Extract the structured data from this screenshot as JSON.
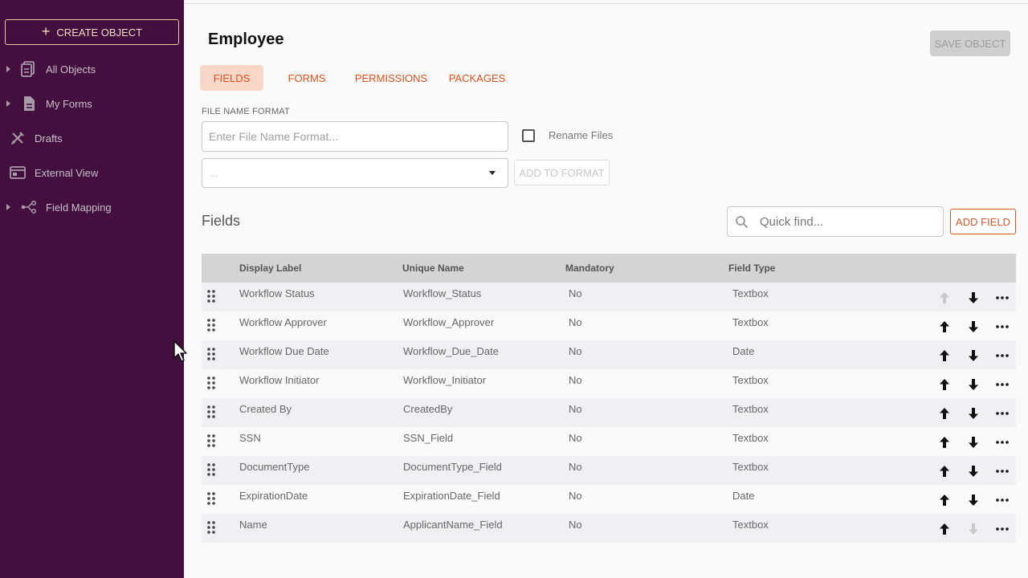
{
  "sidebar": {
    "create_label": "CREATE OBJECT",
    "items": [
      {
        "label": "All Objects",
        "icon": "objects-icon",
        "expandable": true
      },
      {
        "label": "My Forms",
        "icon": "forms-icon",
        "expandable": true
      },
      {
        "label": "Drafts",
        "icon": "drafts-icon",
        "expandable": false
      },
      {
        "label": "External View",
        "icon": "external-view-icon",
        "expandable": false
      },
      {
        "label": "Field Mapping",
        "icon": "field-mapping-icon",
        "expandable": true
      }
    ]
  },
  "header": {
    "title": "Employee",
    "save_label": "SAVE OBJECT"
  },
  "tabs": [
    {
      "label": "FIELDS",
      "active": true
    },
    {
      "label": "FORMS",
      "active": false
    },
    {
      "label": "PERMISSIONS",
      "active": false
    },
    {
      "label": "PACKAGES",
      "active": false
    }
  ],
  "file_name": {
    "label": "FILE NAME FORMAT",
    "placeholder": "Enter File Name Format...",
    "rename_label": "Rename Files",
    "select_value": "...",
    "add_to_format_label": "ADD TO FORMAT"
  },
  "fields_section": {
    "heading": "Fields",
    "search_placeholder": "Quick find...",
    "add_field_label": "ADD FIELD"
  },
  "table": {
    "columns": [
      "Display Label",
      "Unique Name",
      "Mandatory",
      "Field Type"
    ],
    "rows": [
      {
        "display": "Workflow Status",
        "unique": "Workflow_Status",
        "mandatory": "No",
        "type": "Textbox"
      },
      {
        "display": "Workflow Approver",
        "unique": "Workflow_Approver",
        "mandatory": "No",
        "type": "Textbox"
      },
      {
        "display": "Workflow Due Date",
        "unique": "Workflow_Due_Date",
        "mandatory": "No",
        "type": "Date"
      },
      {
        "display": "Workflow Initiator",
        "unique": "Workflow_Initiator",
        "mandatory": "No",
        "type": "Textbox"
      },
      {
        "display": "Created By",
        "unique": "CreatedBy",
        "mandatory": "No",
        "type": "Textbox"
      },
      {
        "display": "SSN",
        "unique": "SSN_Field",
        "mandatory": "No",
        "type": "Textbox"
      },
      {
        "display": "DocumentType",
        "unique": "DocumentType_Field",
        "mandatory": "No",
        "type": "Textbox"
      },
      {
        "display": "ExpirationDate",
        "unique": "ExpirationDate_Field",
        "mandatory": "No",
        "type": "Date"
      },
      {
        "display": "Name",
        "unique": "ApplicantName_Field",
        "mandatory": "No",
        "type": "Textbox"
      }
    ]
  },
  "colors": {
    "sidebar_bg": "#420f3f",
    "accent": "#e0521c",
    "tab_active_bg": "#f8d7c9"
  }
}
